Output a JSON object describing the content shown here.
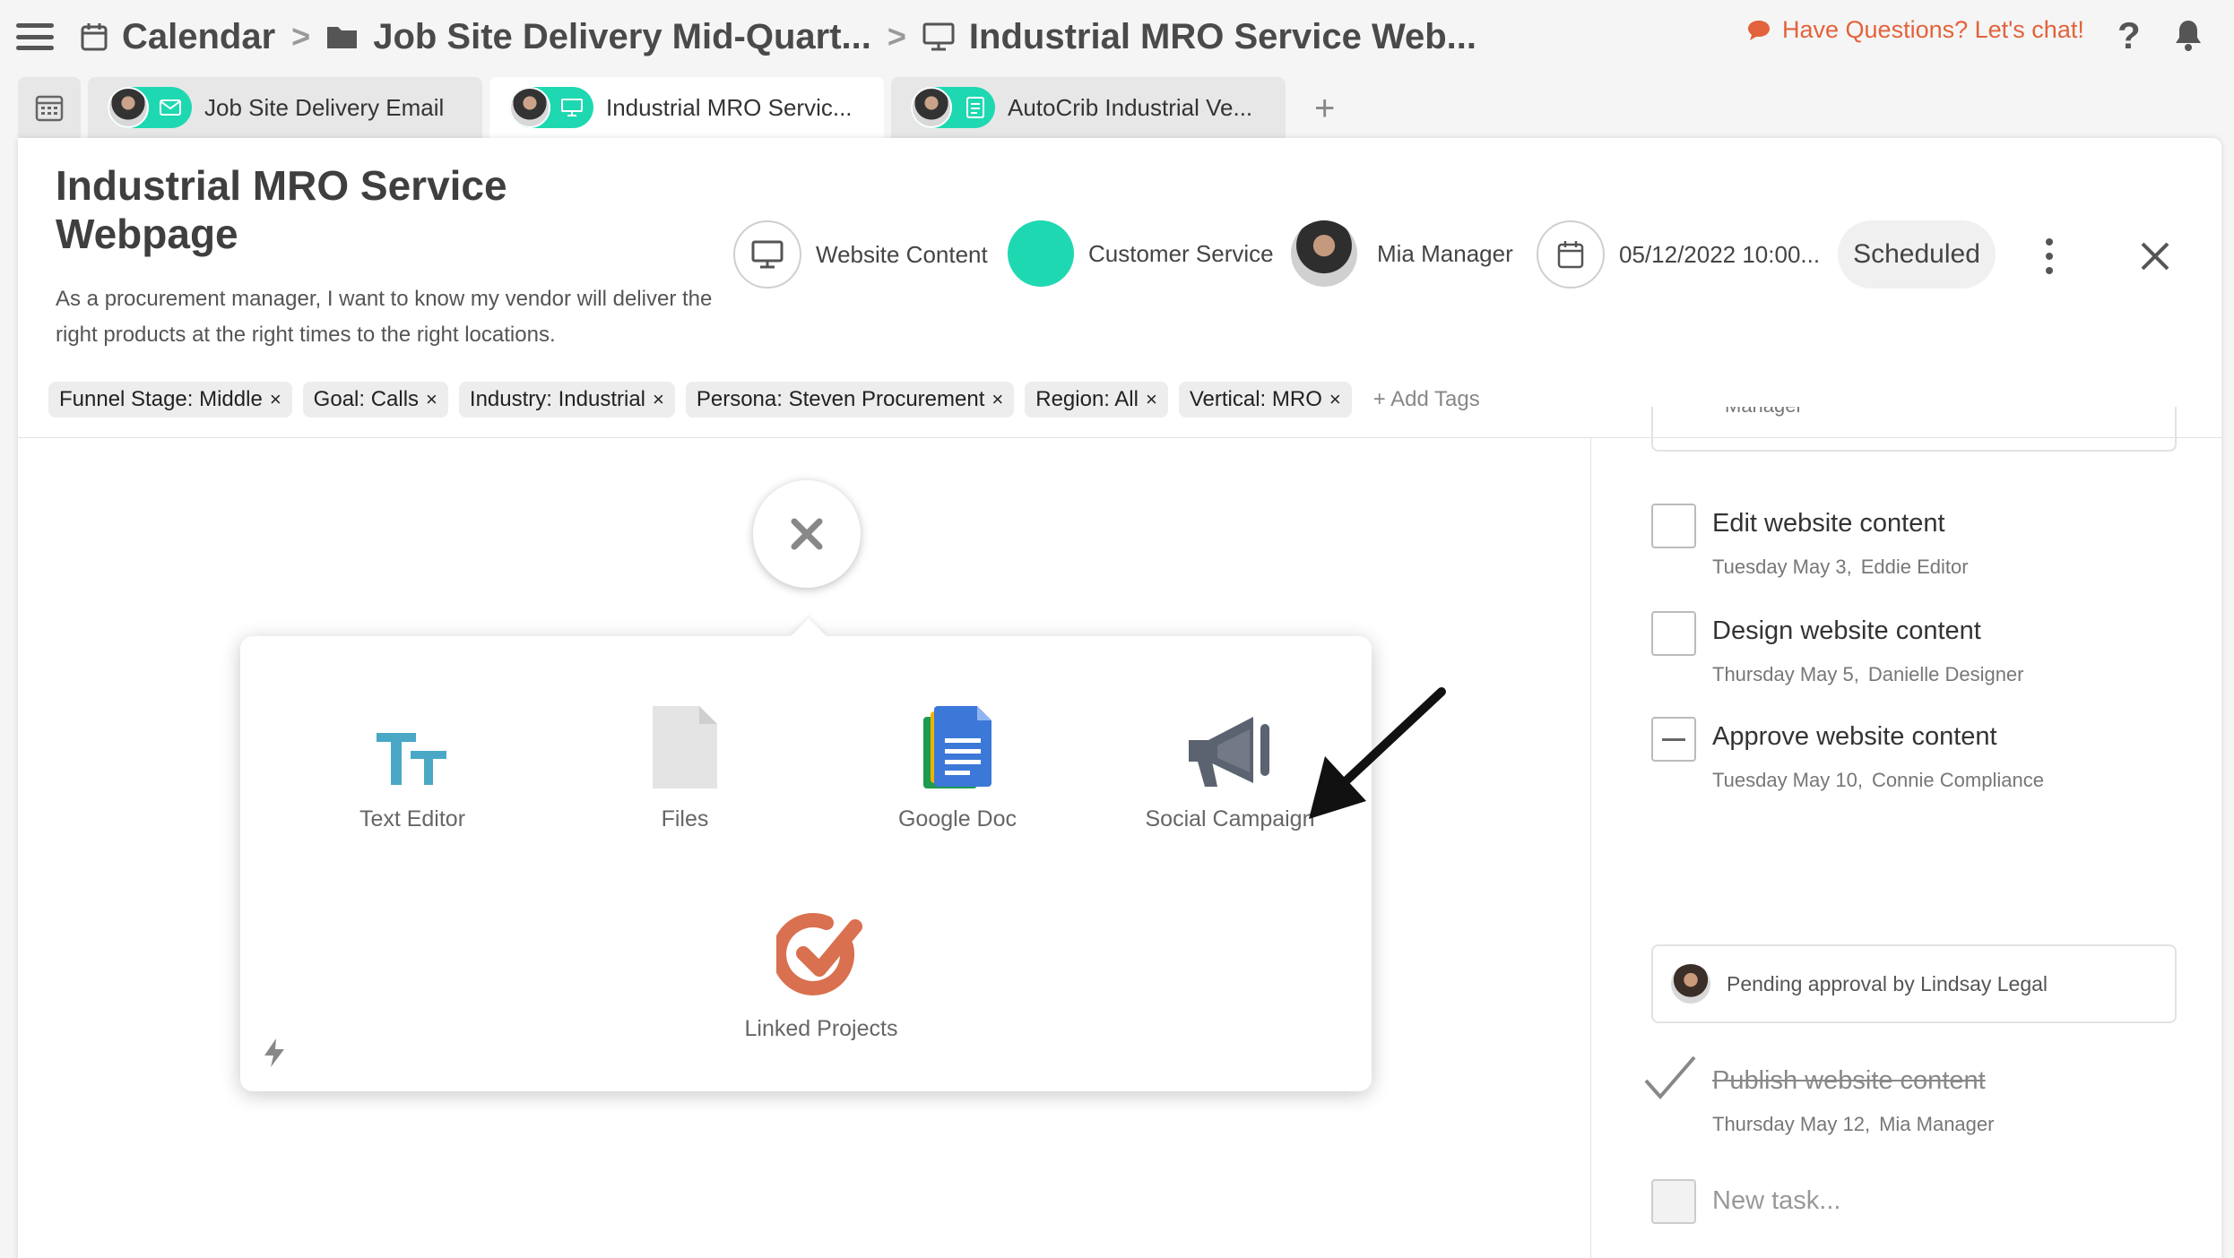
{
  "breadcrumb": {
    "calendar": "Calendar",
    "folder": "Job Site Delivery Mid-Quart...",
    "page": "Industrial MRO Service Web..."
  },
  "header_right": {
    "chat": "Have Questions? Let's chat!",
    "help": "?"
  },
  "tabs": [
    {
      "label": "Job Site Delivery Email",
      "icon": "email-icon"
    },
    {
      "label": "Industrial MRO Servic...",
      "icon": "monitor-icon"
    },
    {
      "label": "AutoCrib Industrial Ve...",
      "icon": "document-icon"
    }
  ],
  "tab_add": "+",
  "card": {
    "title": "Industrial MRO Service Webpage",
    "description": "As a procurement manager, I want to know my vendor will deliver the right products at the right times to the right locations.",
    "content_type": "Website Content",
    "team": "Customer Service",
    "owner": "Mia Manager",
    "datetime": "05/12/2022 10:00...",
    "status": "Scheduled"
  },
  "tags": [
    "Funnel Stage: Middle",
    "Goal: Calls",
    "Industry: Industrial",
    "Persona: Steven Procurement",
    "Region: All",
    "Vertical: MRO"
  ],
  "tag_remove": "×",
  "add_tags": "+ Add Tags",
  "popup": {
    "options": [
      {
        "label": "Text Editor",
        "icon": "text-editor-icon"
      },
      {
        "label": "Files",
        "icon": "file-icon"
      },
      {
        "label": "Google Doc",
        "icon": "google-doc-icon"
      },
      {
        "label": "Social Campaign",
        "icon": "megaphone-icon"
      },
      {
        "label": "Linked Projects",
        "icon": "linked-projects-icon"
      }
    ]
  },
  "tasks": {
    "top_partial": "Manager",
    "items": [
      {
        "title": "Edit website content",
        "date": "Tuesday May 3,",
        "assignee": "Eddie Editor",
        "state": "open"
      },
      {
        "title": "Design website content",
        "date": "Thursday May 5,",
        "assignee": "Danielle Designer",
        "state": "open"
      },
      {
        "title": "Approve website content",
        "date": "Tuesday May 10,",
        "assignee": "Connie Compliance",
        "state": "pending"
      },
      {
        "title": "Publish website content",
        "date": "Thursday May 12,",
        "assignee": "Mia Manager",
        "state": "done"
      }
    ],
    "pending_note": "Pending approval by Lindsay Legal",
    "new_task_placeholder": "New task..."
  },
  "colors": {
    "accent": "#1ed8b1",
    "chat": "#e2633b",
    "text_editor": "#4aa8c6",
    "megaphone": "#5b6270",
    "linked": "#d9704f"
  }
}
